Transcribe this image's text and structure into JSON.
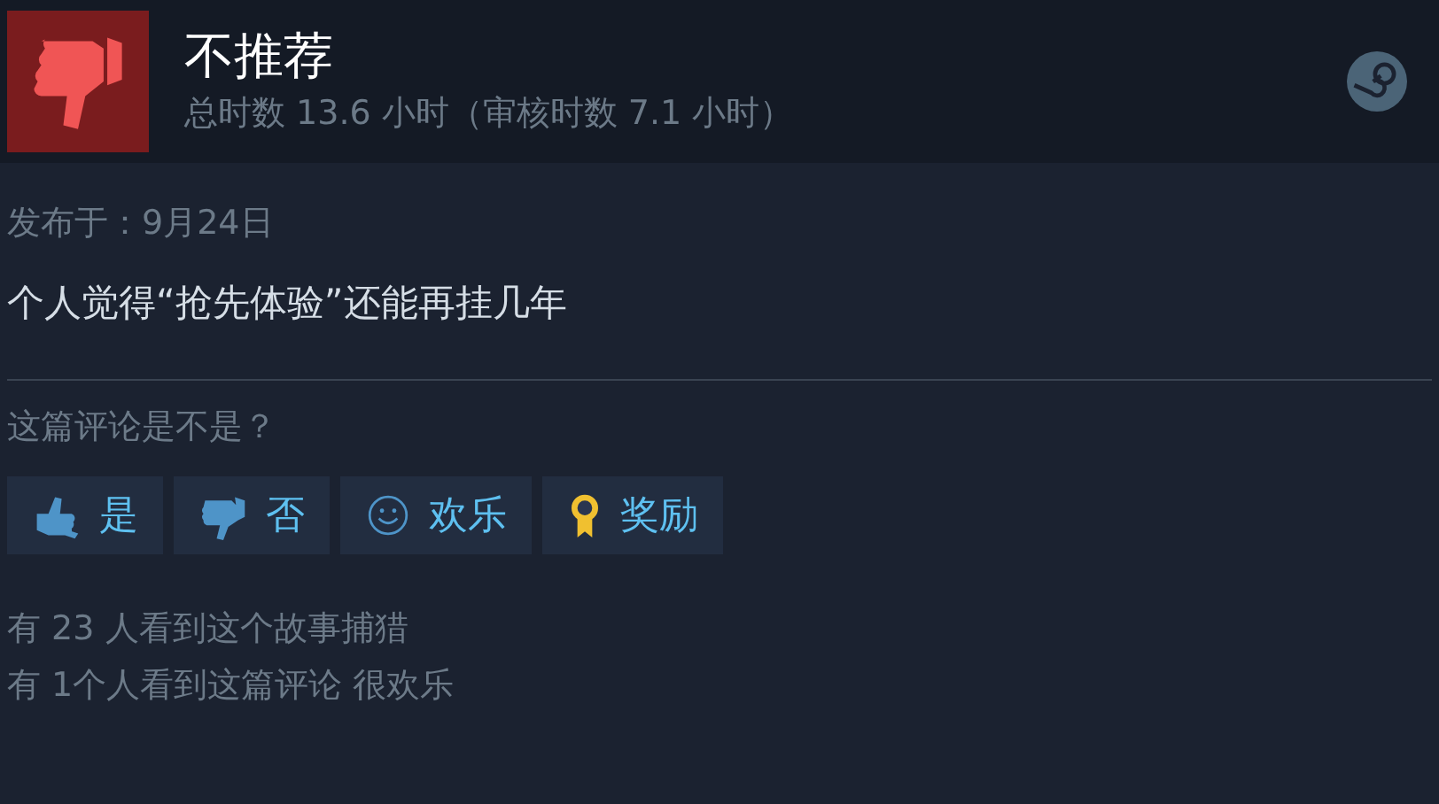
{
  "review": {
    "verdict": "不推荐",
    "recommended": false,
    "playtime": "总时数 13.6 小时（审核时数 7.1 小时）"
  },
  "posted": "发布于：9月24日",
  "body": "个人觉得“抢先体验”还能再挂几年",
  "helpful_prompt": "这篇评论是不是？",
  "buttons": [
    {
      "kind": "thumbs-up",
      "label": "是"
    },
    {
      "kind": "thumbs-down",
      "label": "否"
    },
    {
      "kind": "smile",
      "label": "欢乐"
    },
    {
      "kind": "award",
      "label": "奖励"
    }
  ],
  "stats": [
    "有 23 人看到这个故事捕猎",
    "有 1个人看到这篇评论 很欢乐"
  ]
}
